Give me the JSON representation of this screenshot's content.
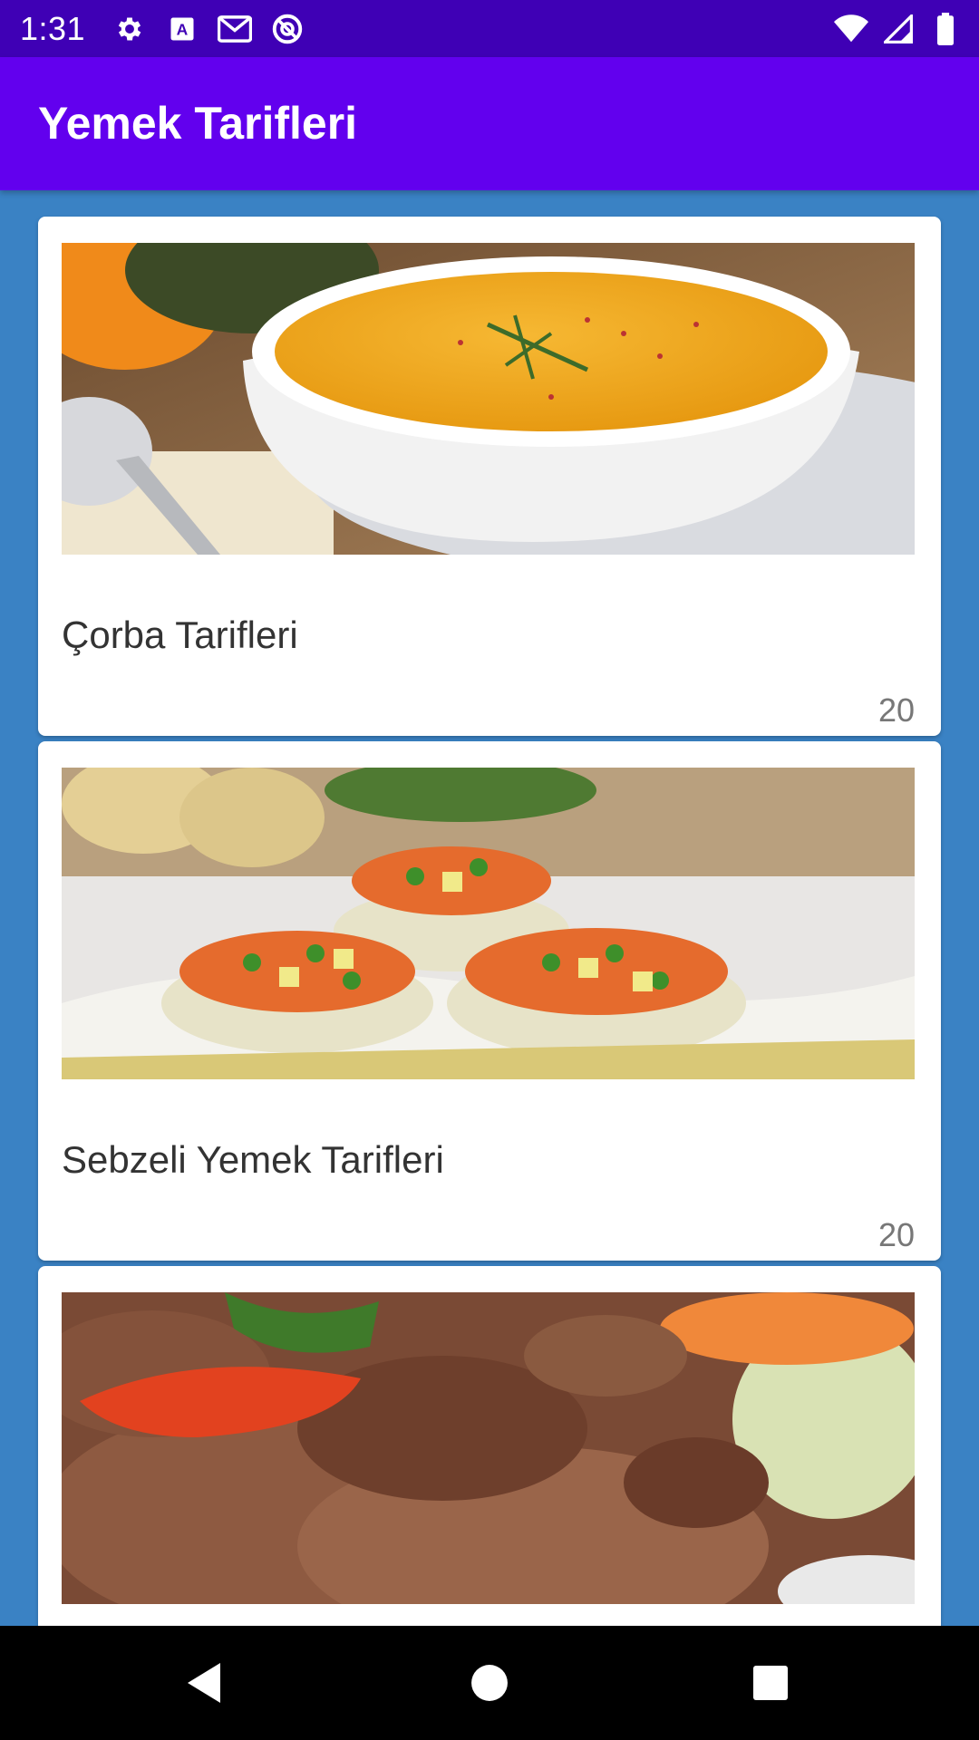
{
  "status_bar": {
    "time": "1:31",
    "left_icons": [
      "gear-icon",
      "font-a-icon",
      "gmail-icon",
      "circle-at-icon"
    ],
    "right_icons": [
      "wifi-icon",
      "signal-icon",
      "battery-icon"
    ]
  },
  "app_bar": {
    "title": "Yemek Tarifleri",
    "color": "#6200ee"
  },
  "colors": {
    "status_bar": "#3f00b5",
    "background": "#3a82c4",
    "card": "#ffffff"
  },
  "categories": [
    {
      "title": "Çorba Tarifleri",
      "count": "20",
      "image": "soup-bowl-image"
    },
    {
      "title": "Sebzeli Yemek Tarifleri",
      "count": "20",
      "image": "vegetable-dish-image"
    },
    {
      "title": "",
      "count": "",
      "image": "meat-dish-image"
    }
  ],
  "nav_bar": {
    "buttons": [
      "back-triangle-icon",
      "home-circle-icon",
      "recents-square-icon"
    ]
  }
}
